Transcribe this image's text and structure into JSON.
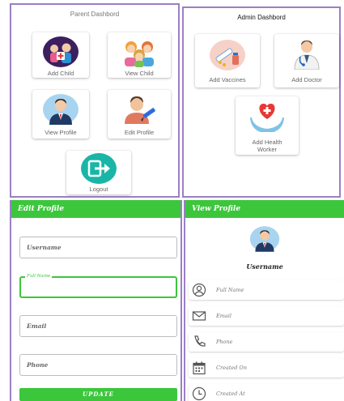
{
  "parent_dashboard": {
    "title": "Parent Dashbord",
    "cards": [
      {
        "label": "Add Child",
        "icon": "add-child-icon"
      },
      {
        "label": "View Child",
        "icon": "children-icon"
      },
      {
        "label": "View Profile",
        "icon": "profile-icon"
      },
      {
        "label": "Edit Profile",
        "icon": "edit-profile-icon"
      },
      {
        "label": "Logout",
        "icon": "logout-icon"
      }
    ]
  },
  "admin_dashboard": {
    "title": "Admin Dashbord",
    "cards": [
      {
        "label": "Add Vaccines",
        "icon": "vaccine-icon"
      },
      {
        "label": "Add Doctor",
        "icon": "doctor-icon"
      },
      {
        "label_line1": "Add Health",
        "label_line2": "Worker",
        "icon": "health-worker-icon"
      }
    ]
  },
  "edit_profile": {
    "title": "Edit Profile",
    "fields": [
      {
        "placeholder": "Username"
      },
      {
        "floating_label": "Full Name"
      },
      {
        "placeholder": "Email"
      },
      {
        "placeholder": "Phone"
      }
    ],
    "update_label": "UPDATE"
  },
  "view_profile": {
    "title": "View Profile",
    "username": "Username",
    "rows": [
      {
        "label": "Full Name",
        "icon": "person-icon"
      },
      {
        "label": "Email",
        "icon": "mail-icon"
      },
      {
        "label": "Phone",
        "icon": "phone-icon"
      },
      {
        "label": "Created On",
        "icon": "calendar-icon"
      },
      {
        "label": "Created At",
        "icon": "clock-icon"
      }
    ]
  },
  "colors": {
    "accent_green": "#3cc63c",
    "panel_border": "#9b7fc4"
  }
}
